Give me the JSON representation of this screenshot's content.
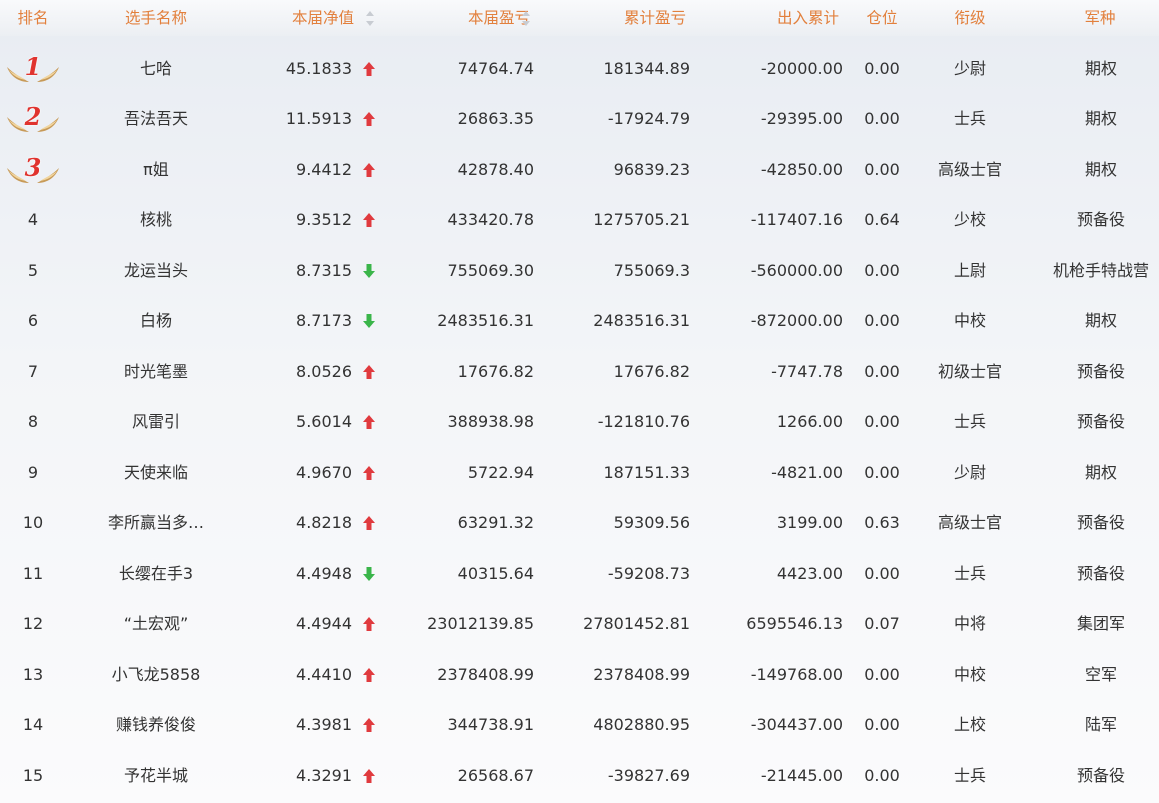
{
  "header": {
    "rank": "排名",
    "name": "选手名称",
    "nav": "本届净值",
    "current_pnl": "本届盈亏",
    "cumulative_pnl": "累计盈亏",
    "net_flow": "出入累计",
    "position": "仓位",
    "title": "衔级",
    "branch": "军种"
  },
  "colors": {
    "header_text": "#e2803d",
    "up": "#e03a3e",
    "down": "#3ab54a",
    "medal_number": "#e0332e"
  },
  "rows": [
    {
      "rank": "1",
      "medal": true,
      "name": "七哈",
      "nav": "45.1833",
      "trend": "up",
      "current_pnl": "74764.74",
      "cumulative_pnl": "181344.89",
      "net_flow": "-20000.00",
      "position": "0.00",
      "title": "少尉",
      "branch": "期权"
    },
    {
      "rank": "2",
      "medal": true,
      "name": "吾法吾天",
      "nav": "11.5913",
      "trend": "up",
      "current_pnl": "26863.35",
      "cumulative_pnl": "-17924.79",
      "net_flow": "-29395.00",
      "position": "0.00",
      "title": "士兵",
      "branch": "期权"
    },
    {
      "rank": "3",
      "medal": true,
      "name": "π姐",
      "nav": "9.4412",
      "trend": "up",
      "current_pnl": "42878.40",
      "cumulative_pnl": "96839.23",
      "net_flow": "-42850.00",
      "position": "0.00",
      "title": "高级士官",
      "branch": "期权"
    },
    {
      "rank": "4",
      "medal": false,
      "name": "核桃",
      "nav": "9.3512",
      "trend": "up",
      "current_pnl": "433420.78",
      "cumulative_pnl": "1275705.21",
      "net_flow": "-117407.16",
      "position": "0.64",
      "title": "少校",
      "branch": "预备役"
    },
    {
      "rank": "5",
      "medal": false,
      "name": "龙运当头",
      "nav": "8.7315",
      "trend": "down",
      "current_pnl": "755069.30",
      "cumulative_pnl": "755069.3",
      "net_flow": "-560000.00",
      "position": "0.00",
      "title": "上尉",
      "branch": "机枪手特战营"
    },
    {
      "rank": "6",
      "medal": false,
      "name": "白杨",
      "nav": "8.7173",
      "trend": "down",
      "current_pnl": "2483516.31",
      "cumulative_pnl": "2483516.31",
      "net_flow": "-872000.00",
      "position": "0.00",
      "title": "中校",
      "branch": "期权"
    },
    {
      "rank": "7",
      "medal": false,
      "name": "时光笔墨",
      "nav": "8.0526",
      "trend": "up",
      "current_pnl": "17676.82",
      "cumulative_pnl": "17676.82",
      "net_flow": "-7747.78",
      "position": "0.00",
      "title": "初级士官",
      "branch": "预备役"
    },
    {
      "rank": "8",
      "medal": false,
      "name": "风雷引",
      "nav": "5.6014",
      "trend": "up",
      "current_pnl": "388938.98",
      "cumulative_pnl": "-121810.76",
      "net_flow": "1266.00",
      "position": "0.00",
      "title": "士兵",
      "branch": "预备役"
    },
    {
      "rank": "9",
      "medal": false,
      "name": "天使来临",
      "nav": "4.9670",
      "trend": "up",
      "current_pnl": "5722.94",
      "cumulative_pnl": "187151.33",
      "net_flow": "-4821.00",
      "position": "0.00",
      "title": "少尉",
      "branch": "期权"
    },
    {
      "rank": "10",
      "medal": false,
      "name": "李所赢当多…",
      "nav": "4.8218",
      "trend": "up",
      "current_pnl": "63291.32",
      "cumulative_pnl": "59309.56",
      "net_flow": "3199.00",
      "position": "0.63",
      "title": "高级士官",
      "branch": "预备役"
    },
    {
      "rank": "11",
      "medal": false,
      "name": "长缨在手3",
      "nav": "4.4948",
      "trend": "down",
      "current_pnl": "40315.64",
      "cumulative_pnl": "-59208.73",
      "net_flow": "4423.00",
      "position": "0.00",
      "title": "士兵",
      "branch": "预备役"
    },
    {
      "rank": "12",
      "medal": false,
      "name": "“土宏观”",
      "nav": "4.4944",
      "trend": "up",
      "current_pnl": "23012139.85",
      "cumulative_pnl": "27801452.81",
      "net_flow": "6595546.13",
      "position": "0.07",
      "title": "中将",
      "branch": "集团军"
    },
    {
      "rank": "13",
      "medal": false,
      "name": "小飞龙5858",
      "nav": "4.4410",
      "trend": "up",
      "current_pnl": "2378408.99",
      "cumulative_pnl": "2378408.99",
      "net_flow": "-149768.00",
      "position": "0.00",
      "title": "中校",
      "branch": "空军"
    },
    {
      "rank": "14",
      "medal": false,
      "name": "赚钱养俊俊",
      "nav": "4.3981",
      "trend": "up",
      "current_pnl": "344738.91",
      "cumulative_pnl": "4802880.95",
      "net_flow": "-304437.00",
      "position": "0.00",
      "title": "上校",
      "branch": "陆军"
    },
    {
      "rank": "15",
      "medal": false,
      "name": "予花半城",
      "nav": "4.3291",
      "trend": "up",
      "current_pnl": "26568.67",
      "cumulative_pnl": "-39827.69",
      "net_flow": "-21445.00",
      "position": "0.00",
      "title": "士兵",
      "branch": "预备役"
    }
  ]
}
